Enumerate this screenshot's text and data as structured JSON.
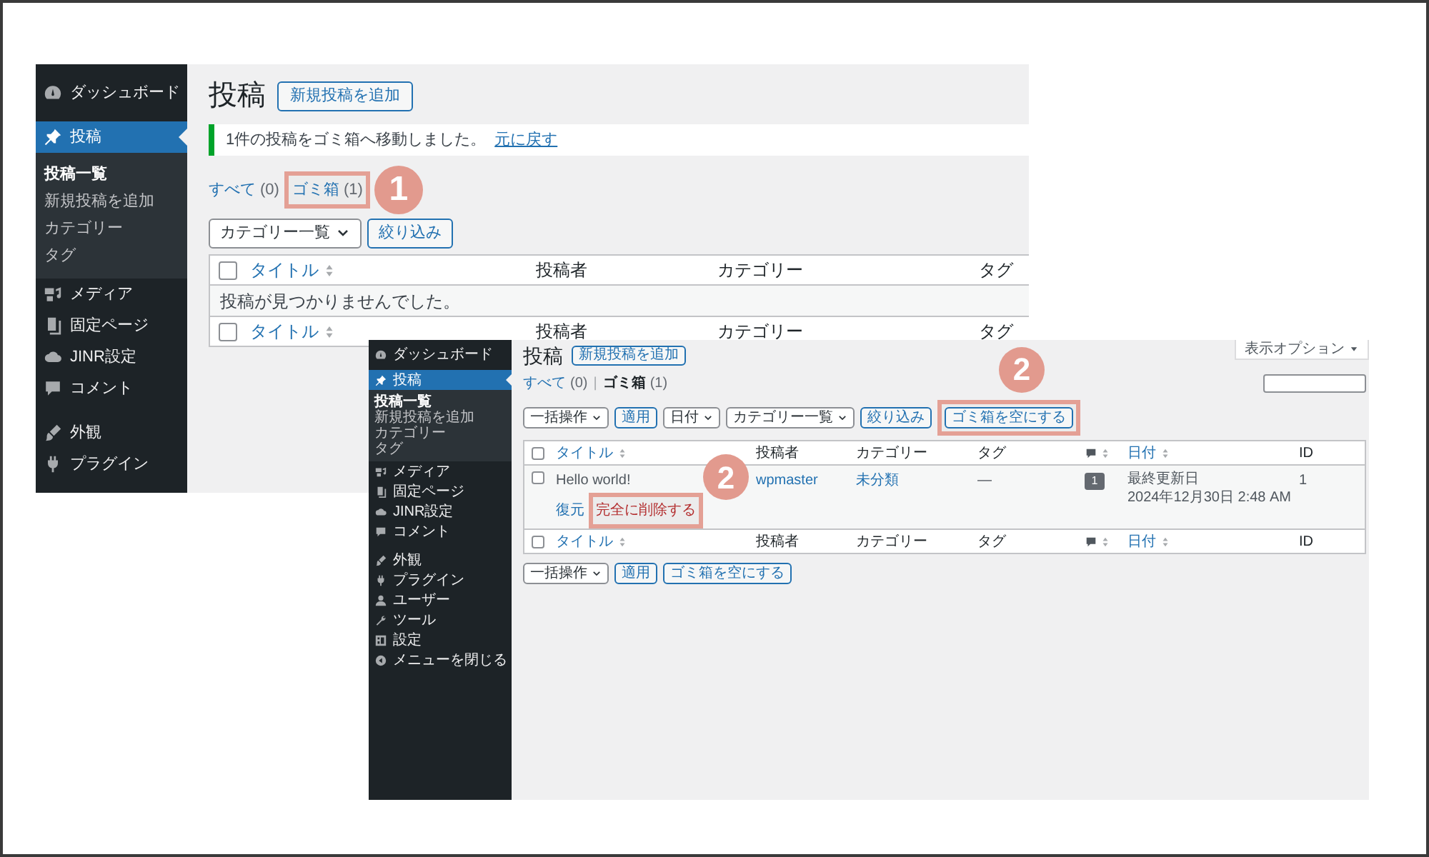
{
  "screenshots": [
    {
      "sidebar": [
        {
          "label": "ダッシュボード",
          "current": false
        },
        {
          "label": "投稿",
          "current": true,
          "children": [
            {
              "label": "投稿一覧",
              "current": true
            },
            {
              "label": "新規投稿を追加",
              "current": false
            },
            {
              "label": "カテゴリー",
              "current": false
            },
            {
              "label": "タグ",
              "current": false
            }
          ]
        },
        {
          "label": "メディア",
          "current": false
        },
        {
          "label": "固定ページ",
          "current": false
        },
        {
          "label": "JINR設定",
          "current": false
        },
        {
          "label": "コメント",
          "current": false
        },
        {
          "label": "外観",
          "current": false
        },
        {
          "label": "プラグイン",
          "current": false
        }
      ],
      "page_title": "投稿",
      "add_button": "新規投稿を追加",
      "notice": {
        "text": "1件の投稿をゴミ箱へ移動しました。",
        "link": "元に戻す"
      },
      "filters": [
        {
          "label": "すべて",
          "count": "(0)",
          "selected": false
        },
        {
          "label": "ゴミ箱",
          "count": "(1)",
          "selected": false,
          "step": "1"
        }
      ],
      "toolbar": [
        {
          "kind": "select",
          "label": "カテゴリー一覧"
        },
        {
          "kind": "button",
          "label": "絞り込み"
        }
      ],
      "select_all_checked": false,
      "columns": [
        {
          "kind": "text",
          "label": "タイトル",
          "sortable": true
        },
        {
          "kind": "text",
          "label": "投稿者",
          "sortable": false
        },
        {
          "kind": "text",
          "label": "カテゴリー",
          "sortable": false
        },
        {
          "kind": "text",
          "label": "タグ",
          "sortable": false
        }
      ],
      "empty_message": "投稿が見つかりませんでした。",
      "footer_select_all_checked": false,
      "footer_columns": [
        {
          "kind": "text",
          "label": "タイトル",
          "sortable": true
        },
        {
          "kind": "text",
          "label": "投稿者",
          "sortable": false
        },
        {
          "kind": "text",
          "label": "カテゴリー",
          "sortable": false
        },
        {
          "kind": "text",
          "label": "タグ",
          "sortable": false
        }
      ]
    },
    {
      "sidebar": [
        {
          "label": "ダッシュボード",
          "current": false
        },
        {
          "label": "投稿",
          "current": true,
          "children": [
            {
              "label": "投稿一覧",
              "current": true
            },
            {
              "label": "新規投稿を追加",
              "current": false
            },
            {
              "label": "カテゴリー",
              "current": false
            },
            {
              "label": "タグ",
              "current": false
            }
          ]
        },
        {
          "label": "メディア",
          "current": false
        },
        {
          "label": "固定ページ",
          "current": false
        },
        {
          "label": "JINR設定",
          "current": false
        },
        {
          "label": "コメント",
          "current": false
        },
        {
          "label": "外観",
          "current": false
        },
        {
          "label": "プラグイン",
          "current": false
        },
        {
          "label": "ユーザー",
          "current": false
        },
        {
          "label": "ツール",
          "current": false
        },
        {
          "label": "設定",
          "current": false
        },
        {
          "label": "メニューを閉じる",
          "current": false
        }
      ],
      "screen_options": "表示オプション",
      "page_title": "投稿",
      "add_button": "新規投稿を追加",
      "filters": [
        {
          "label": "すべて",
          "count": "(0)",
          "selected": false,
          "separator": "|"
        },
        {
          "label": "ゴミ箱",
          "count": "(1)",
          "selected": true
        }
      ],
      "search_box": true,
      "toolbar": [
        {
          "kind": "select",
          "label": "一括操作"
        },
        {
          "kind": "button",
          "label": "適用"
        },
        {
          "kind": "select",
          "label": "日付"
        },
        {
          "kind": "select",
          "label": "カテゴリー一覧"
        },
        {
          "kind": "button",
          "label": "絞り込み"
        },
        {
          "kind": "button",
          "label": "ゴミ箱を空にする",
          "step": "2"
        }
      ],
      "select_all_checked": false,
      "columns": [
        {
          "kind": "text",
          "label": "タイトル",
          "sortable": true
        },
        {
          "kind": "text",
          "label": "投稿者",
          "sortable": false
        },
        {
          "kind": "text",
          "label": "カテゴリー",
          "sortable": false
        },
        {
          "kind": "text",
          "label": "タグ",
          "sortable": false
        },
        {
          "kind": "comments",
          "sortable": true
        },
        {
          "kind": "text",
          "label": "日付",
          "sortable": true
        },
        {
          "kind": "text",
          "label": "ID",
          "sortable": false
        }
      ],
      "rows": [
        {
          "checked": false,
          "title": "Hello world!",
          "actions": [
            {
              "label": "復元",
              "kind": "restore"
            },
            {
              "label": "完全に削除する",
              "kind": "delete",
              "step": "2"
            }
          ],
          "author": "wpmaster",
          "category": "未分類",
          "tags": "—",
          "comments": "1",
          "date_status": "最終更新日",
          "date": "2024年12月30日 2:48 AM",
          "id": "1"
        }
      ],
      "footer_select_all_checked": false,
      "footer_columns": [
        {
          "kind": "text",
          "label": "タイトル",
          "sortable": true
        },
        {
          "kind": "text",
          "label": "投稿者",
          "sortable": false
        },
        {
          "kind": "text",
          "label": "カテゴリー",
          "sortable": false
        },
        {
          "kind": "text",
          "label": "タグ",
          "sortable": false
        },
        {
          "kind": "comments",
          "sortable": true
        },
        {
          "kind": "text",
          "label": "日付",
          "sortable": true
        },
        {
          "kind": "text",
          "label": "ID",
          "sortable": false
        }
      ],
      "bottom_toolbar": [
        {
          "kind": "select",
          "label": "一括操作"
        },
        {
          "kind": "button",
          "label": "適用"
        },
        {
          "kind": "button",
          "label": "ゴミ箱を空にする"
        }
      ]
    }
  ]
}
